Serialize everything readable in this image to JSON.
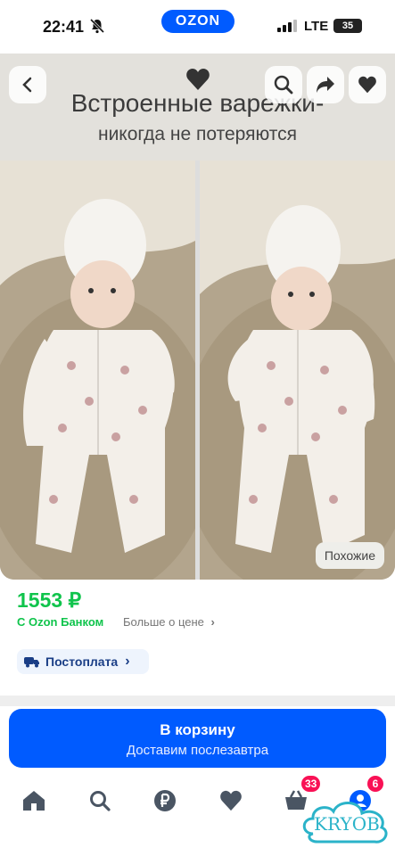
{
  "status_bar": {
    "time": "22:41",
    "network": "LTE",
    "battery": "35"
  },
  "app": {
    "logo": "OZON"
  },
  "banner": {
    "line1": "Встроенные варежки-",
    "line2": "никогда не потеряются"
  },
  "hero_buttons": {
    "back": "chevron-left-icon",
    "favorite_center": "heart-icon",
    "search": "search-icon",
    "share": "share-icon",
    "favorite": "heart-icon"
  },
  "gallery": {
    "similar_label": "Похожие"
  },
  "price": {
    "value": "1553 ₽",
    "bank_label": "С Ozon Банком",
    "more_label": "Больше о цене"
  },
  "payment": {
    "postpay_label": "Постоплата"
  },
  "cart": {
    "title": "В корзину",
    "subtitle": "Доставим послезавтра"
  },
  "tabbar": {
    "cart_badge": "33",
    "profile_badge": "6"
  },
  "watermark": {
    "text": "KRYOB"
  },
  "colors": {
    "brand_blue": "#005bff",
    "price_green": "#10c44c",
    "badge_pink": "#f91155"
  }
}
